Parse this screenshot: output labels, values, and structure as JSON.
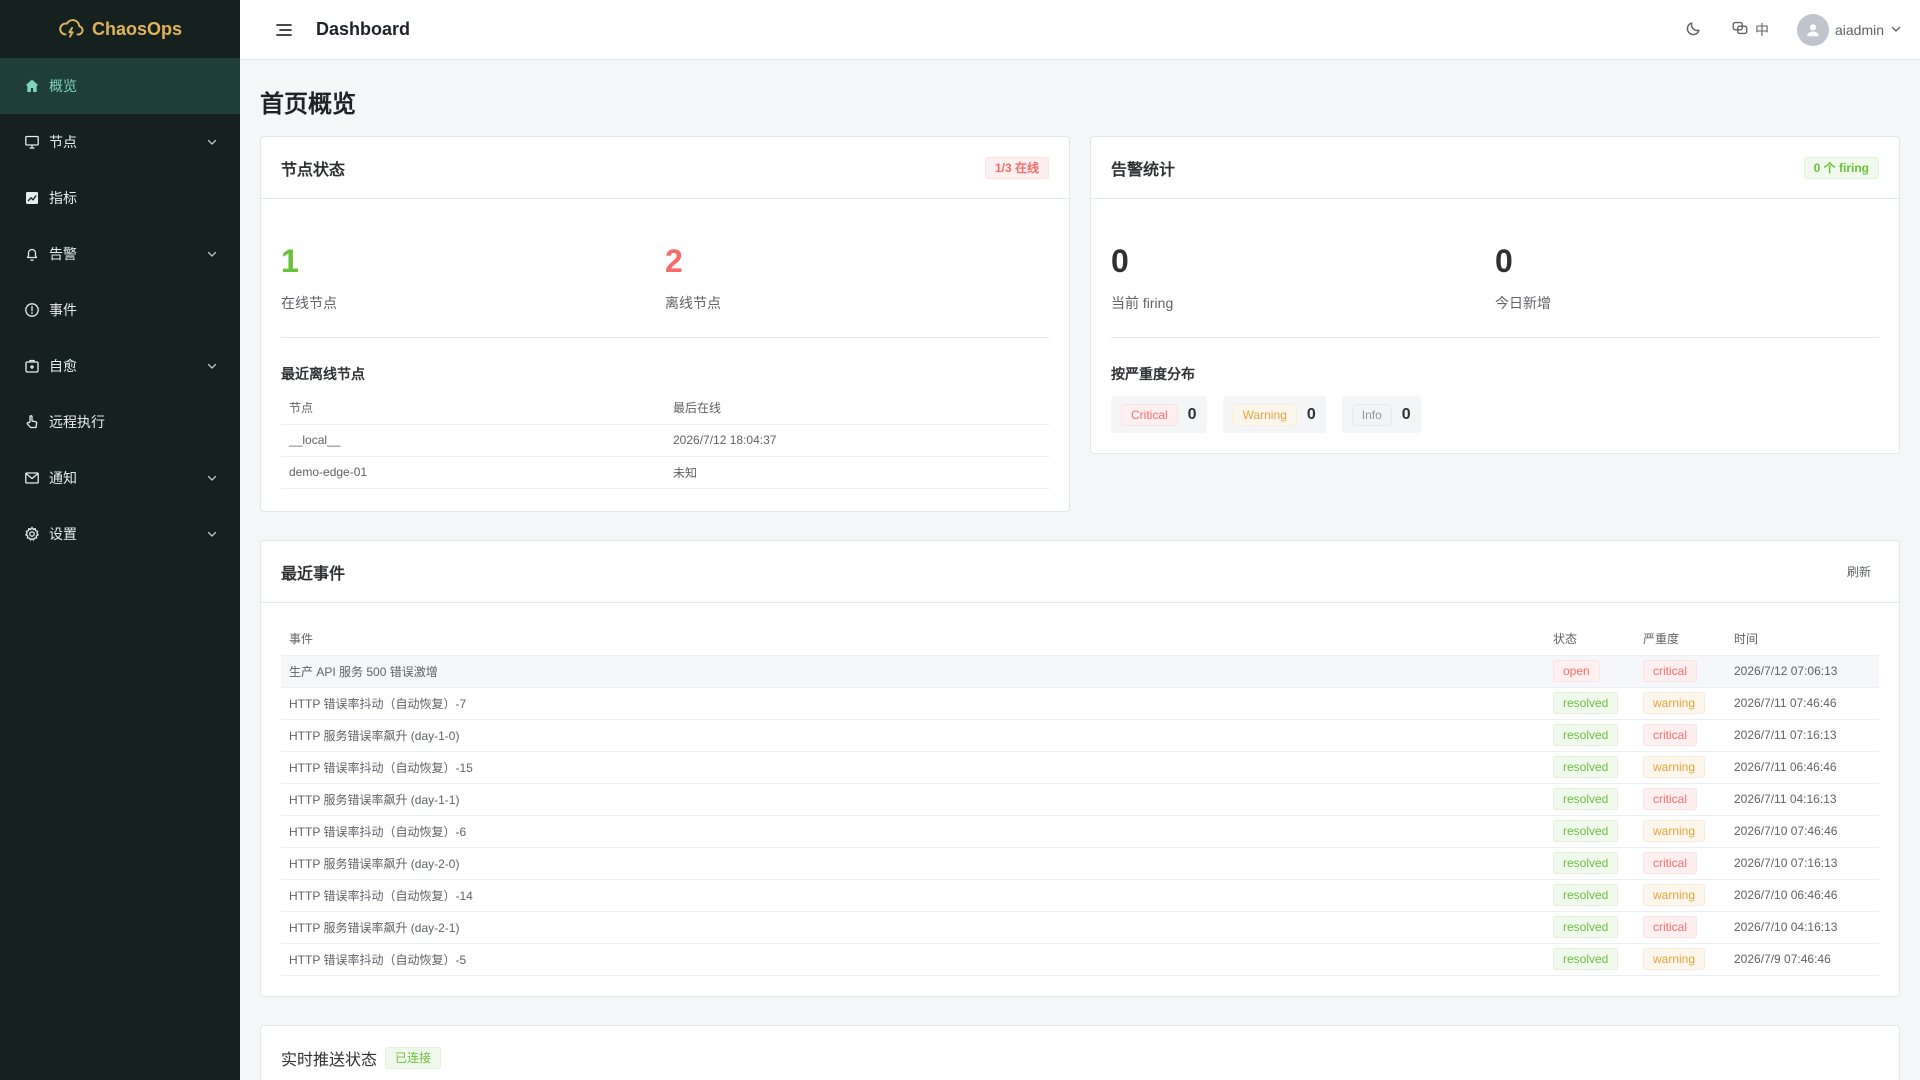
{
  "brand": {
    "name": "ChaosOps"
  },
  "sidebar": {
    "items": [
      {
        "label": "概览",
        "icon": "home-icon",
        "expandable": false,
        "active": true
      },
      {
        "label": "节点",
        "icon": "monitor-icon",
        "expandable": true
      },
      {
        "label": "指标",
        "icon": "chart-icon",
        "expandable": false
      },
      {
        "label": "告警",
        "icon": "bell-icon",
        "expandable": true
      },
      {
        "label": "事件",
        "icon": "alert-circle-icon",
        "expandable": false
      },
      {
        "label": "自愈",
        "icon": "first-aid-icon",
        "expandable": true
      },
      {
        "label": "远程执行",
        "icon": "hand-pointer-icon",
        "expandable": false
      },
      {
        "label": "通知",
        "icon": "mail-icon",
        "expandable": true
      },
      {
        "label": "设置",
        "icon": "gear-icon",
        "expandable": true
      }
    ]
  },
  "topbar": {
    "title": "Dashboard",
    "lang_label": "中",
    "user_name": "aiadmin"
  },
  "page": {
    "title": "首页概览"
  },
  "node_status": {
    "title": "节点状态",
    "badge": "1/3 在线",
    "online_count": "1",
    "online_label": "在线节点",
    "offline_count": "2",
    "offline_label": "离线节点",
    "recent_title": "最近离线节点",
    "columns": {
      "node": "节点",
      "last_online": "最后在线"
    },
    "rows": [
      {
        "node": "__local__",
        "last_online": "2026/7/12 18:04:37"
      },
      {
        "node": "demo-edge-01",
        "last_online": "未知"
      }
    ]
  },
  "alert_stats": {
    "title": "告警统计",
    "badge": "0 个 firing",
    "firing_count": "0",
    "firing_label": "当前 firing",
    "today_count": "0",
    "today_label": "今日新增",
    "severity_title": "按严重度分布",
    "severities": [
      {
        "label": "Critical",
        "count": "0",
        "color": "#f56c6c"
      },
      {
        "label": "Warning",
        "count": "0",
        "color": "#e6a23c"
      },
      {
        "label": "Info",
        "count": "0",
        "color": "#909399"
      }
    ]
  },
  "events": {
    "title": "最近事件",
    "refresh_label": "刷新",
    "columns": {
      "event": "事件",
      "status": "状态",
      "severity": "严重度",
      "time": "时间"
    },
    "rows": [
      {
        "event": "生产 API 服务 500 错误激增",
        "status": "open",
        "severity": "critical",
        "time": "2026/7/12 07:06:13"
      },
      {
        "event": "HTTP 错误率抖动（自动恢复）-7",
        "status": "resolved",
        "severity": "warning",
        "time": "2026/7/11 07:46:46"
      },
      {
        "event": "HTTP 服务错误率飙升 (day-1-0)",
        "status": "resolved",
        "severity": "critical",
        "time": "2026/7/11 07:16:13"
      },
      {
        "event": "HTTP 错误率抖动（自动恢复）-15",
        "status": "resolved",
        "severity": "warning",
        "time": "2026/7/11 06:46:46"
      },
      {
        "event": "HTTP 服务错误率飙升 (day-1-1)",
        "status": "resolved",
        "severity": "critical",
        "time": "2026/7/11 04:16:13"
      },
      {
        "event": "HTTP 错误率抖动（自动恢复）-6",
        "status": "resolved",
        "severity": "warning",
        "time": "2026/7/10 07:46:46"
      },
      {
        "event": "HTTP 服务错误率飙升 (day-2-0)",
        "status": "resolved",
        "severity": "critical",
        "time": "2026/7/10 07:16:13"
      },
      {
        "event": "HTTP 错误率抖动（自动恢复）-14",
        "status": "resolved",
        "severity": "warning",
        "time": "2026/7/10 06:46:46"
      },
      {
        "event": "HTTP 服务错误率飙升 (day-2-1)",
        "status": "resolved",
        "severity": "critical",
        "time": "2026/7/10 04:16:13"
      },
      {
        "event": "HTTP 错误率抖动（自动恢复）-5",
        "status": "resolved",
        "severity": "warning",
        "time": "2026/7/9 07:46:46"
      }
    ]
  },
  "push_status": {
    "title": "实时推送状态",
    "badge": "已连接"
  },
  "colors": {
    "sidebar_bg": "#14211f",
    "sidebar_active_bg": "#1f3d39",
    "brand_accent": "#e0b35a",
    "success": "#67c23a",
    "danger": "#f56c6c",
    "warning": "#e6a23c",
    "info": "#909399"
  }
}
